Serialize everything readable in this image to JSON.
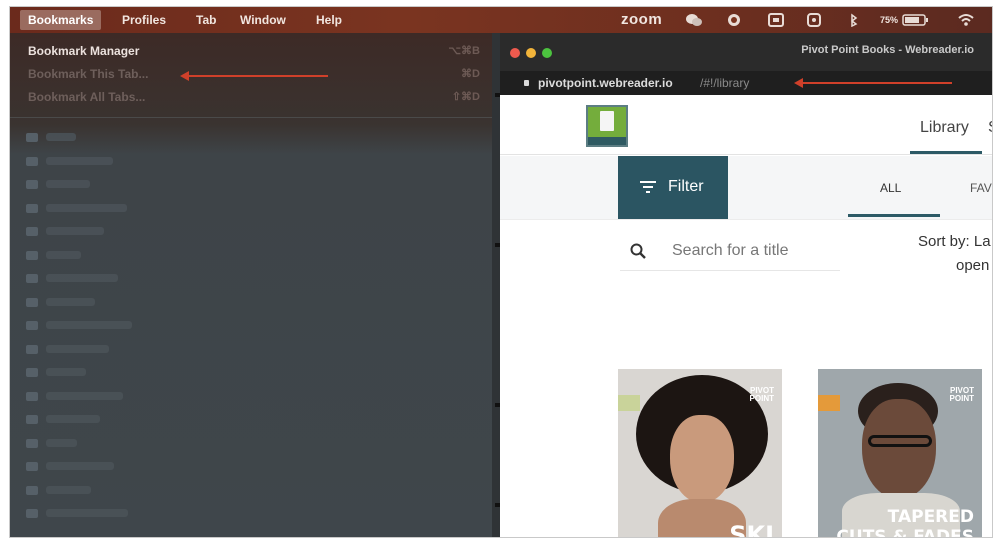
{
  "menubar": {
    "items": [
      "Bookmarks",
      "Profiles",
      "Tab",
      "Window",
      "Help"
    ],
    "status": {
      "zoom": "zoom",
      "battery": "75%"
    }
  },
  "bookmarks_menu": {
    "items": [
      {
        "label": "Bookmark Manager",
        "shortcut": "⌥⌘B"
      },
      {
        "label": "Bookmark This Tab...",
        "shortcut": "⌘D"
      },
      {
        "label": "Bookmark All Tabs...",
        "shortcut": "⇧⌘D"
      }
    ]
  },
  "browser": {
    "window_title": "Pivot Point Books - Webreader.io",
    "url": "pivotpoint.webreader.io",
    "url_path": "/#!/library"
  },
  "page": {
    "nav_library": "Library",
    "nav_next": "S",
    "filter_label": "Filter",
    "tab_all": "ALL",
    "tab_fav": "FAV",
    "search_placeholder": "Search for a title",
    "sort_line1": "Sort by: La",
    "sort_line2": "open",
    "books": [
      {
        "brand": "PIVOT\nPOINT",
        "title": "SKI"
      },
      {
        "brand": "PIVOT\nPOINT",
        "title_line1": "TAPERED",
        "title_line2": "CUTS & FADES"
      }
    ]
  },
  "colors": {
    "menubar": "#7a3420",
    "arrow": "#d0402a",
    "filter_bg": "#2b5562",
    "logo_green": "#74ad3c"
  }
}
